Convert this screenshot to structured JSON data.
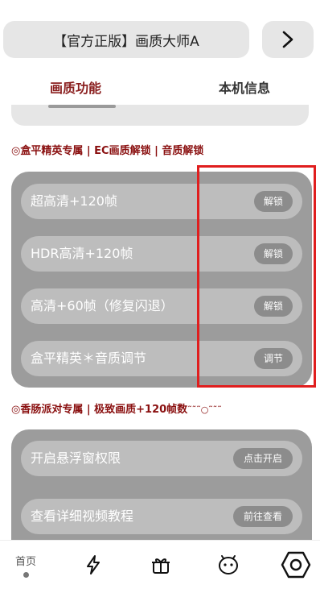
{
  "header": {
    "title": "【官方正版】画质大师A",
    "next_icon": "chevron-right-icon"
  },
  "tabs": [
    {
      "label": "画质功能",
      "active": true
    },
    {
      "label": "本机信息",
      "active": false
    }
  ],
  "section1": {
    "title": "◎盒平精英专属 | EC画质解锁 | 音质解锁",
    "items": [
      {
        "label": "超高清+120帧",
        "action": "解锁"
      },
      {
        "label": "HDR高清+120帧",
        "action": "解锁"
      },
      {
        "label": "高清+60帧（修复闪退）",
        "action": "解锁"
      },
      {
        "label": "盒平精英＊音质调节",
        "action": "调节"
      }
    ]
  },
  "section2": {
    "title": "◎香肠派对专属 | 极致画质+120帧数",
    "title_suffix": "˜˜˜○˜˜˜",
    "items": [
      {
        "label": "开启悬浮窗权限",
        "action": "点击开启"
      },
      {
        "label": "查看详细视频教程",
        "action": "前往查看"
      }
    ]
  },
  "bottom_nav": {
    "items": [
      {
        "label": "首页",
        "icon": "home",
        "active": true
      },
      {
        "label": "",
        "icon": "lightning-icon"
      },
      {
        "label": "",
        "icon": "gift-icon"
      },
      {
        "label": "",
        "icon": "face-icon"
      },
      {
        "label": "",
        "icon": "hexagon-settings-icon"
      }
    ]
  },
  "colors": {
    "accent": "#8a1010",
    "highlight": "#e01e1e",
    "card": "#9c9c9c",
    "row": "#bdbdbd",
    "button": "#8c8c8c"
  }
}
